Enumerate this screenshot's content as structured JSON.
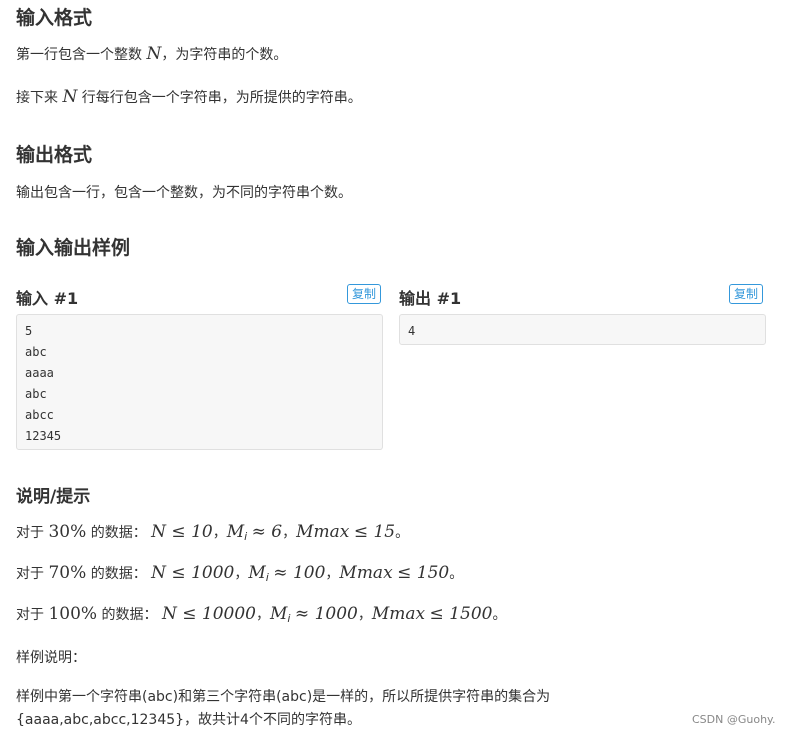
{
  "input_format": {
    "title": "输入格式",
    "line1_pre": "第一行包含一个整数",
    "line1_var": "N",
    "line1_post": "，为字符串的个数。",
    "line2_pre": "接下来",
    "line2_var": "N",
    "line2_post": "行每行包含一个字符串，为所提供的字符串。"
  },
  "output_format": {
    "title": "输出格式",
    "line1": "输出包含一行，包含一个整数，为不同的字符串个数。"
  },
  "samples": {
    "title": "输入输出样例",
    "input_label": "输入 #1",
    "output_label": "输出 #1",
    "copy_label": "复制",
    "input_lines": [
      "5",
      "abc",
      "aaaa",
      "abc",
      "abcc",
      "12345"
    ],
    "output_lines": [
      "4"
    ]
  },
  "hint": {
    "title": "说明/提示",
    "rows": [
      {
        "pre": "对于",
        "pct": "30%",
        "mid": "的数据：",
        "n_cond": "N ≤ 10",
        "m_cond": "≈ 6",
        "max_cond": "≤ 15"
      },
      {
        "pre": "对于",
        "pct": "70%",
        "mid": "的数据：",
        "n_cond": "N ≤ 1000",
        "m_cond": "≈ 100",
        "max_cond": "≤ 150"
      },
      {
        "pre": "对于",
        "pct": "100%",
        "mid": "的数据：",
        "n_cond": "N ≤ 10000",
        "m_cond": "≈ 1000",
        "max_cond": "≤ 1500"
      }
    ],
    "m_var": "M",
    "m_sub": "i",
    "max_var": "Mmax",
    "sep": "，",
    "end": "。",
    "sample_note_title": "样例说明：",
    "sample_note_line1": "样例中第一个字符串(abc)和第三个字符串(abc)是一样的，所以所提供字符串的集合为",
    "sample_note_line2": "{aaaa,abc,abcc,12345}，故共计4个不同的字符串。"
  },
  "watermark": "CSDN @Guohy."
}
